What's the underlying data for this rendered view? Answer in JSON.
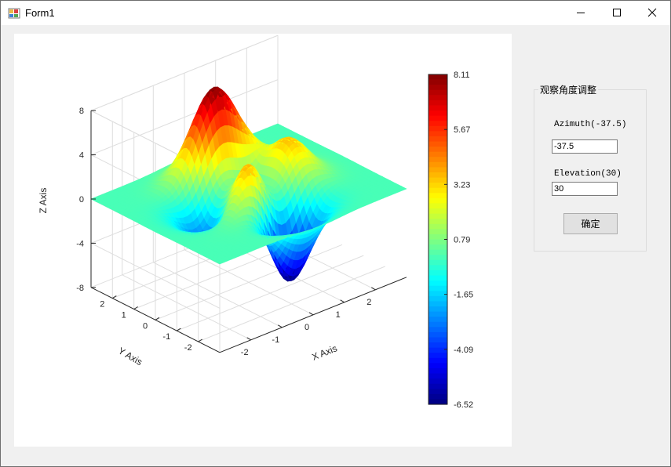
{
  "window": {
    "title": "Form1"
  },
  "chart_data": {
    "type": "surface",
    "xlabel": "X Axis",
    "ylabel": "Y Axis",
    "zlabel": "Z Axis",
    "x_ticks": [
      -2,
      -1,
      0,
      1,
      2
    ],
    "y_ticks": [
      -2,
      -1,
      0,
      1,
      2
    ],
    "z_ticks": [
      -8,
      -4,
      0,
      4,
      8
    ],
    "xlim": [
      -3,
      3
    ],
    "ylim": [
      -3,
      3
    ],
    "zlim": [
      -8,
      8
    ],
    "grid": true,
    "colormap": "jet",
    "colorbar": {
      "range": [
        -6.52,
        8.11
      ],
      "ticks": [
        "8.11",
        "5.67",
        "3.23",
        "0.79",
        "-1.65",
        "-4.09",
        "-6.52"
      ]
    },
    "view": {
      "azimuth": -37.5,
      "elevation": 30
    }
  },
  "view_panel": {
    "title": "观察角度调整",
    "azimuth_label": "Azimuth(-37.5)",
    "azimuth_value": "-37.5",
    "elevation_label": "Elevation(30)",
    "elevation_value": "30",
    "confirm_label": "确定"
  }
}
